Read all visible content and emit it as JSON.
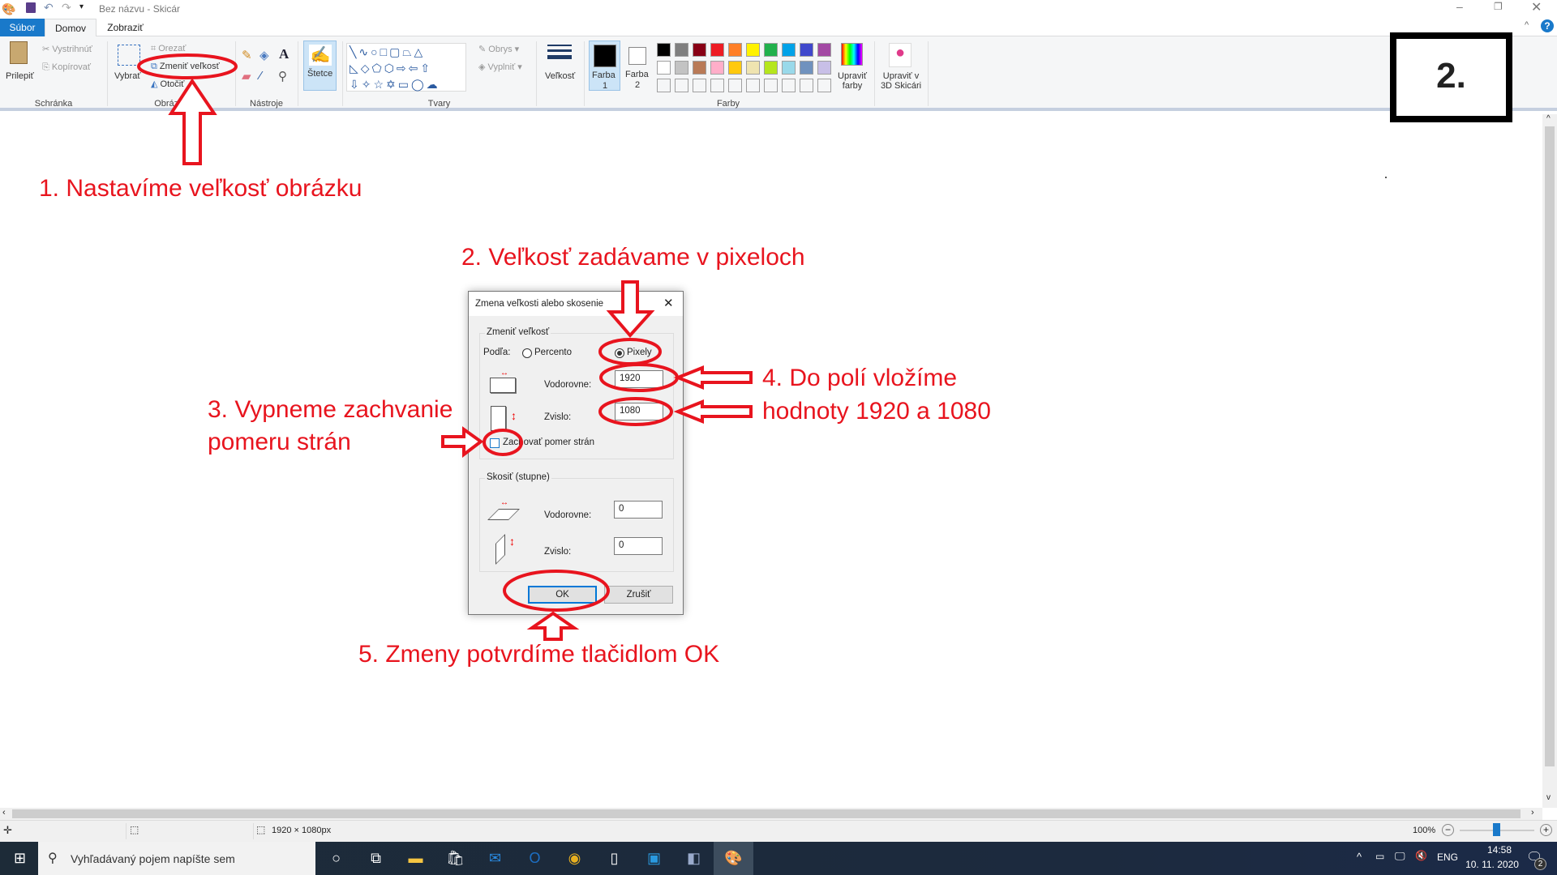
{
  "window": {
    "title": "Bez názvu - Skicár"
  },
  "tabs": [
    {
      "label": "Súbor"
    },
    {
      "label": "Domov"
    },
    {
      "label": "Zobraziť"
    }
  ],
  "ribbon": {
    "clipboard": {
      "paste": "Prilepiť",
      "cut": "Vystrihnúť",
      "copy": "Kopírovať",
      "group": "Schránka"
    },
    "image": {
      "select": "Vybrať",
      "crop": "Orezať",
      "resize": "Zmeniť veľkosť",
      "rotate": "Otočiť",
      "group": "Obrázok"
    },
    "tools": {
      "group": "Nástroje"
    },
    "brushes": {
      "label": "Štetce"
    },
    "shapes": {
      "outline": "Obrys",
      "fill": "Vyplniť",
      "group": "Tvary"
    },
    "size": {
      "label": "Veľkosť"
    },
    "colors": {
      "color1": "Farba",
      "color1_num": "1",
      "color2": "Farba",
      "color2_num": "2",
      "edit": "Upraviť",
      "edit2": "farby",
      "group": "Farby",
      "palette_row1": [
        "#000000",
        "#7f7f7f",
        "#880015",
        "#ed1c24",
        "#ff7f27",
        "#fff200",
        "#22b14c",
        "#00a2e8",
        "#3f48cc",
        "#a349a4"
      ],
      "palette_row2": [
        "#ffffff",
        "#c3c3c3",
        "#b97a57",
        "#ffaec9",
        "#ffc90e",
        "#efe4b0",
        "#b5e61d",
        "#99d9ea",
        "#7092be",
        "#c8bfe7"
      ]
    },
    "paint3d": {
      "line1": "Upraviť v",
      "line2": "3D Skicári"
    }
  },
  "step_badge": "2.",
  "annotations": {
    "a1": "1. Nastavíme veľkosť obrázku",
    "a2": "2. Veľkosť zadávame v pixeloch",
    "a3_line1": "3. Vypneme zachvanie",
    "a3_line2": "pomeru strán",
    "a4_line1": "4. Do polí vložíme",
    "a4_line2": "hodnoty 1920 a 1080",
    "a5": "5. Zmeny potvrdíme tlačidlom OK",
    "color": "#e8141e"
  },
  "dialog": {
    "title": "Zmena veľkosti alebo skosenie",
    "resize_group": "Zmeniť veľkosť",
    "by_label": "Podľa:",
    "percent": "Percento",
    "pixels": "Pixely",
    "selected_unit": "Pixely",
    "horizontal": "Vodorovne:",
    "vertical": "Zvislo:",
    "width_value": "1920",
    "height_value": "1080",
    "keep_ratio": "Zachovať pomer strán",
    "keep_ratio_checked": false,
    "skew_group": "Skosiť (stupne)",
    "skew_h": "0",
    "skew_v": "0",
    "ok": "OK",
    "cancel": "Zrušiť"
  },
  "statusbar": {
    "image_size": "1920 × 1080px",
    "zoom": "100%",
    "zoom_level_percent": 100
  },
  "taskbar": {
    "search_placeholder": "Vyhľadávaný pojem napíšte sem",
    "lang": "ENG",
    "time": "14:58",
    "date": "10. 11. 2020",
    "notifications": "2"
  }
}
